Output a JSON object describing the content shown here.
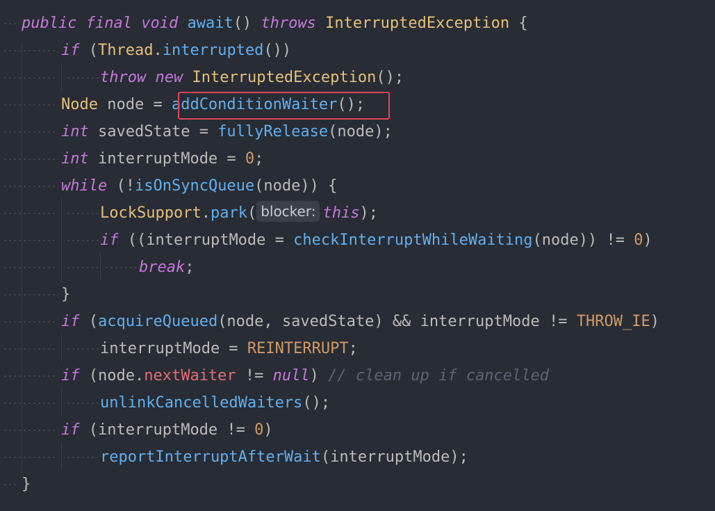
{
  "editor": {
    "highlight_color": "#e0455a",
    "background_color": "#282c34",
    "lines": {
      "l1": {
        "public": "public",
        "final": "final",
        "void": "void",
        "name": "await",
        "parens": "()",
        "throws": "throws",
        "exc": "InterruptedException",
        "brace": "{"
      },
      "l2": {
        "if": "if",
        "open": "(",
        "thread": "Thread",
        "dot": ".",
        "interrupted": "interrupted",
        "close": "())"
      },
      "l3": {
        "throw": "throw",
        "new": "new",
        "exc": "InterruptedException",
        "end": "();"
      },
      "l4": {
        "type": "Node",
        "assign": " node = ",
        "call": "addConditionWaiter",
        "end": "();"
      },
      "l5": {
        "type": "int",
        "assign": " savedState = ",
        "call": "fullyRelease",
        "args": "(node);"
      },
      "l6": {
        "type": "int",
        "assign": " interruptMode = ",
        "zero": "0",
        "end": ";"
      },
      "l7": {
        "while": "while",
        "open": " (!",
        "call": "isOnSyncQueue",
        "args": "(node)) {"
      },
      "l8": {
        "cls": "LockSupport",
        "dot": ".",
        "park": "park",
        "open": "(",
        "hint": "blocker:",
        "this": "this",
        "end": ");"
      },
      "l9": {
        "if": "if",
        "open": " ((interruptMode = ",
        "call": "checkInterruptWhileWaiting",
        "args": "(node)) != ",
        "zero": "0",
        "close": ")"
      },
      "l10": {
        "break": "break",
        "end": ";"
      },
      "l11": {
        "brace": "}"
      },
      "l12": {
        "if": "if",
        "open": " (",
        "call": "acquireQueued",
        "args": "(node, savedState) && interruptMode != ",
        "const": "THROW_IE",
        "close": ")"
      },
      "l13": {
        "assign": "interruptMode = ",
        "const": "REINTERRUPT",
        "end": ";"
      },
      "l14": {
        "if": "if",
        "open": " (node.",
        "field": "nextWaiter",
        "ne": " != ",
        "null": "null",
        "close": ") ",
        "comment": "// clean up if cancelled"
      },
      "l15": {
        "call": "unlinkCancelledWaiters",
        "end": "();"
      },
      "l16": {
        "if": "if",
        "open": " (interruptMode != ",
        "zero": "0",
        "close": ")"
      },
      "l17": {
        "call": "reportInterruptAfterWait",
        "args": "(interruptMode);"
      },
      "l18": {
        "brace": "}"
      }
    }
  }
}
